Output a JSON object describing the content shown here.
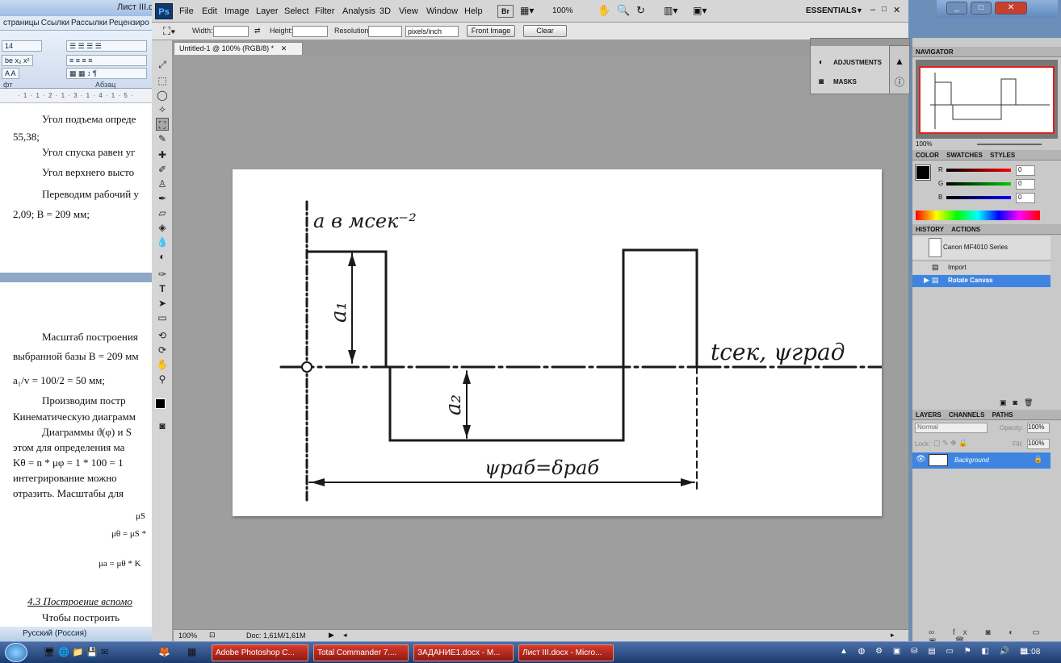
{
  "word": {
    "title": "Лист III.docx",
    "tabs": [
      "страницы",
      "Ссылки",
      "Рассылки",
      "Рецензиро"
    ],
    "font_size": "14",
    "paragraph_group": "Абзац",
    "font_group": "фт",
    "ruler": "· 1 · 1 · 2 · 1 · 3 · 1 · 4 · 1 · 5 ·",
    "lines": [
      "Угол подъема опреде",
      "55,38;",
      "Угол спуска равен уг",
      "Угол верхнего высто",
      "Переводим рабочий у",
      "2,09; B = 209 мм;",
      "Масштаб построения",
      "выбранной базы B = 209 мм",
      "a₁/v = 100/2 = 50 мм;",
      "Производим постр",
      "Кинематическую диаграмм",
      "Диаграммы ϑ(φ) и S",
      "этом для определения ма",
      "Kθ = n * μφ = 1 * 100 = 1",
      "интегрирование можно",
      "отразить. Масштабы для",
      "μS",
      "μθ = μS *",
      "μa = μθ * K",
      "4.3 Построение вспомо",
      "Чтобы построить"
    ],
    "status_language": "Русский (Россия)"
  },
  "photoshop": {
    "menu": [
      "File",
      "Edit",
      "Image",
      "Layer",
      "Select",
      "Filter",
      "Analysis",
      "3D",
      "View",
      "Window",
      "Help"
    ],
    "zoom_menu": "100%",
    "workspace": "ESSENTIALS",
    "options": {
      "width_label": "Width:",
      "height_label": "Height:",
      "resolution_label": "Resolution:",
      "units": "pixels/inch",
      "front_image": "Front Image",
      "clear": "Clear"
    },
    "doc_tab": "Untitled-1 @ 100% (RGB/8) *",
    "status_zoom": "100%",
    "status_doc": "Doc: 1,61M/1,61M",
    "canvas_labels": {
      "y_axis": "a в мсек⁻²",
      "x_axis": "tсек, ψград",
      "a1": "a₁",
      "a2": "a₂",
      "phase": "ψраб=δраб"
    },
    "adjust_panel": {
      "adjustments": "ADJUSTMENTS",
      "masks": "MASKS"
    },
    "navigator": {
      "title": "NAVIGATOR",
      "zoom": "100%"
    },
    "color": {
      "tabs": [
        "COLOR",
        "SWATCHES",
        "STYLES"
      ],
      "r_label": "R",
      "g_label": "G",
      "b_label": "B",
      "r": "0",
      "g": "0",
      "b": "0"
    },
    "history": {
      "tabs": [
        "HISTORY",
        "ACTIONS"
      ],
      "snapshot": "Canon MF4010 Series",
      "items": [
        "Import",
        "Rotate Canvas"
      ]
    },
    "layers": {
      "tabs": [
        "LAYERS",
        "CHANNELS",
        "PATHS"
      ],
      "blend": "Normal",
      "opacity_label": "Opacity:",
      "opacity": "100%",
      "lock_label": "Lock:",
      "fill_label": "Fill:",
      "fill": "100%",
      "layer_name": "Background"
    }
  },
  "taskbar": {
    "tasks": [
      "Adobe Photoshop C...",
      "Total Commander 7....",
      "ЗАДАНИЕ1.docx - M...",
      "Лист III.docx - Micro..."
    ],
    "clock": "11:08"
  }
}
